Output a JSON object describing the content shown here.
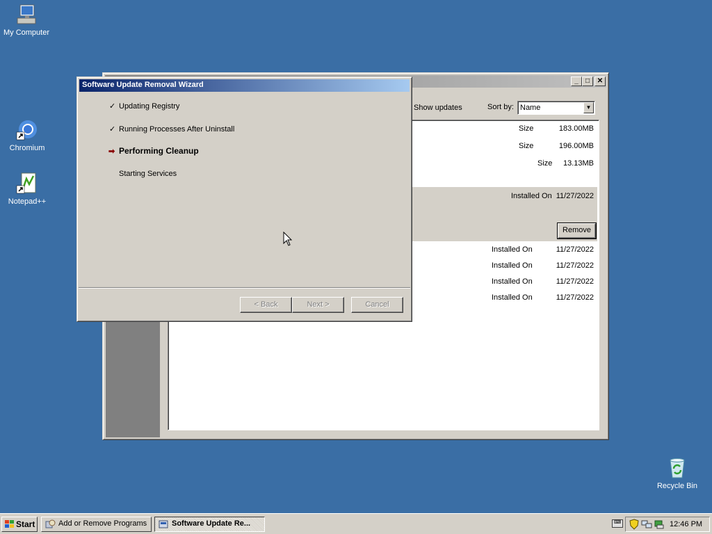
{
  "desktop": {
    "icons": [
      {
        "label": "My Computer",
        "icon": "my-computer-icon"
      },
      {
        "label": "Chromium",
        "icon": "chromium-icon"
      },
      {
        "label": "Notepad++",
        "icon": "notepadpp-icon"
      },
      {
        "label": "Recycle Bin",
        "icon": "recycle-bin-icon"
      }
    ]
  },
  "bg_window": {
    "show_updates_label": "Show updates",
    "sort_by_label": "Sort by:",
    "sort_by_value": "Name",
    "rows": [
      {
        "label": "Size",
        "value": "183.00MB"
      },
      {
        "label": "Size",
        "value": "196.00MB"
      },
      {
        "label": "Size",
        "value": "13.13MB"
      }
    ],
    "selected_row": {
      "label": "Installed On",
      "value": "11/27/2022",
      "remove_label": "Remove"
    },
    "installed_rows": [
      {
        "label": "Installed On",
        "value": "11/27/2022"
      },
      {
        "label": "Installed On",
        "value": "11/27/2022"
      },
      {
        "label": "Installed On",
        "value": "11/27/2022"
      },
      {
        "label": "Installed On",
        "value": "11/27/2022"
      }
    ]
  },
  "wizard": {
    "title": "Software Update Removal Wizard",
    "steps": [
      {
        "label": "Updating Registry",
        "status": "done"
      },
      {
        "label": "Running Processes After Uninstall",
        "status": "done"
      },
      {
        "label": "Performing Cleanup",
        "status": "current"
      },
      {
        "label": "Starting Services",
        "status": "pending"
      }
    ],
    "back_label": "< Back",
    "next_label": "Next >",
    "cancel_label": "Cancel"
  },
  "taskbar": {
    "start_label": "Start",
    "tasks": [
      {
        "label": "Add or Remove Programs",
        "active": false
      },
      {
        "label": "Software Update Re...",
        "active": true
      }
    ],
    "clock": "12:46 PM"
  },
  "colors": {
    "desktop": "#3a6ea5",
    "title_active": "#0a246a",
    "title_inactive": "#808080",
    "face": "#d4d0c8"
  }
}
